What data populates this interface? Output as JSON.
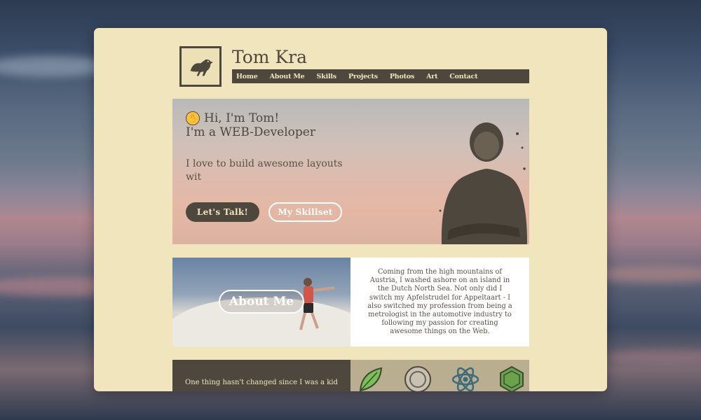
{
  "header": {
    "title": "Tom Kra",
    "nav": [
      "Home",
      "About Me",
      "Skills",
      "Projects",
      "Photos",
      "Art",
      "Contact"
    ]
  },
  "hero": {
    "greeting": "Hi, I'm Tom!",
    "role": "I'm a WEB-Developer",
    "description": "I love to build awesome layouts wit",
    "primary_button": "Let's Talk!",
    "secondary_button": "My Skillset"
  },
  "about": {
    "button": "About Me",
    "text": "Coming from the high mountains of Austria, I washed ashore on an island in the Dutch North Sea. Not only did I switch my Apfelstrudel for Appeltaart - I also switched my profession from being a metrologist in the automotive industry to following my passion for creating awesome things on the Web."
  },
  "story": {
    "text": "One thing hasn't changed since I was a kid"
  },
  "skills": {
    "icons": [
      "leaf-icon",
      "sass-icon",
      "react-icon",
      "nodejs-icon"
    ]
  },
  "colors": {
    "card_bg": "#f1e5be",
    "dark": "#4e473d",
    "white": "#ffffff"
  }
}
